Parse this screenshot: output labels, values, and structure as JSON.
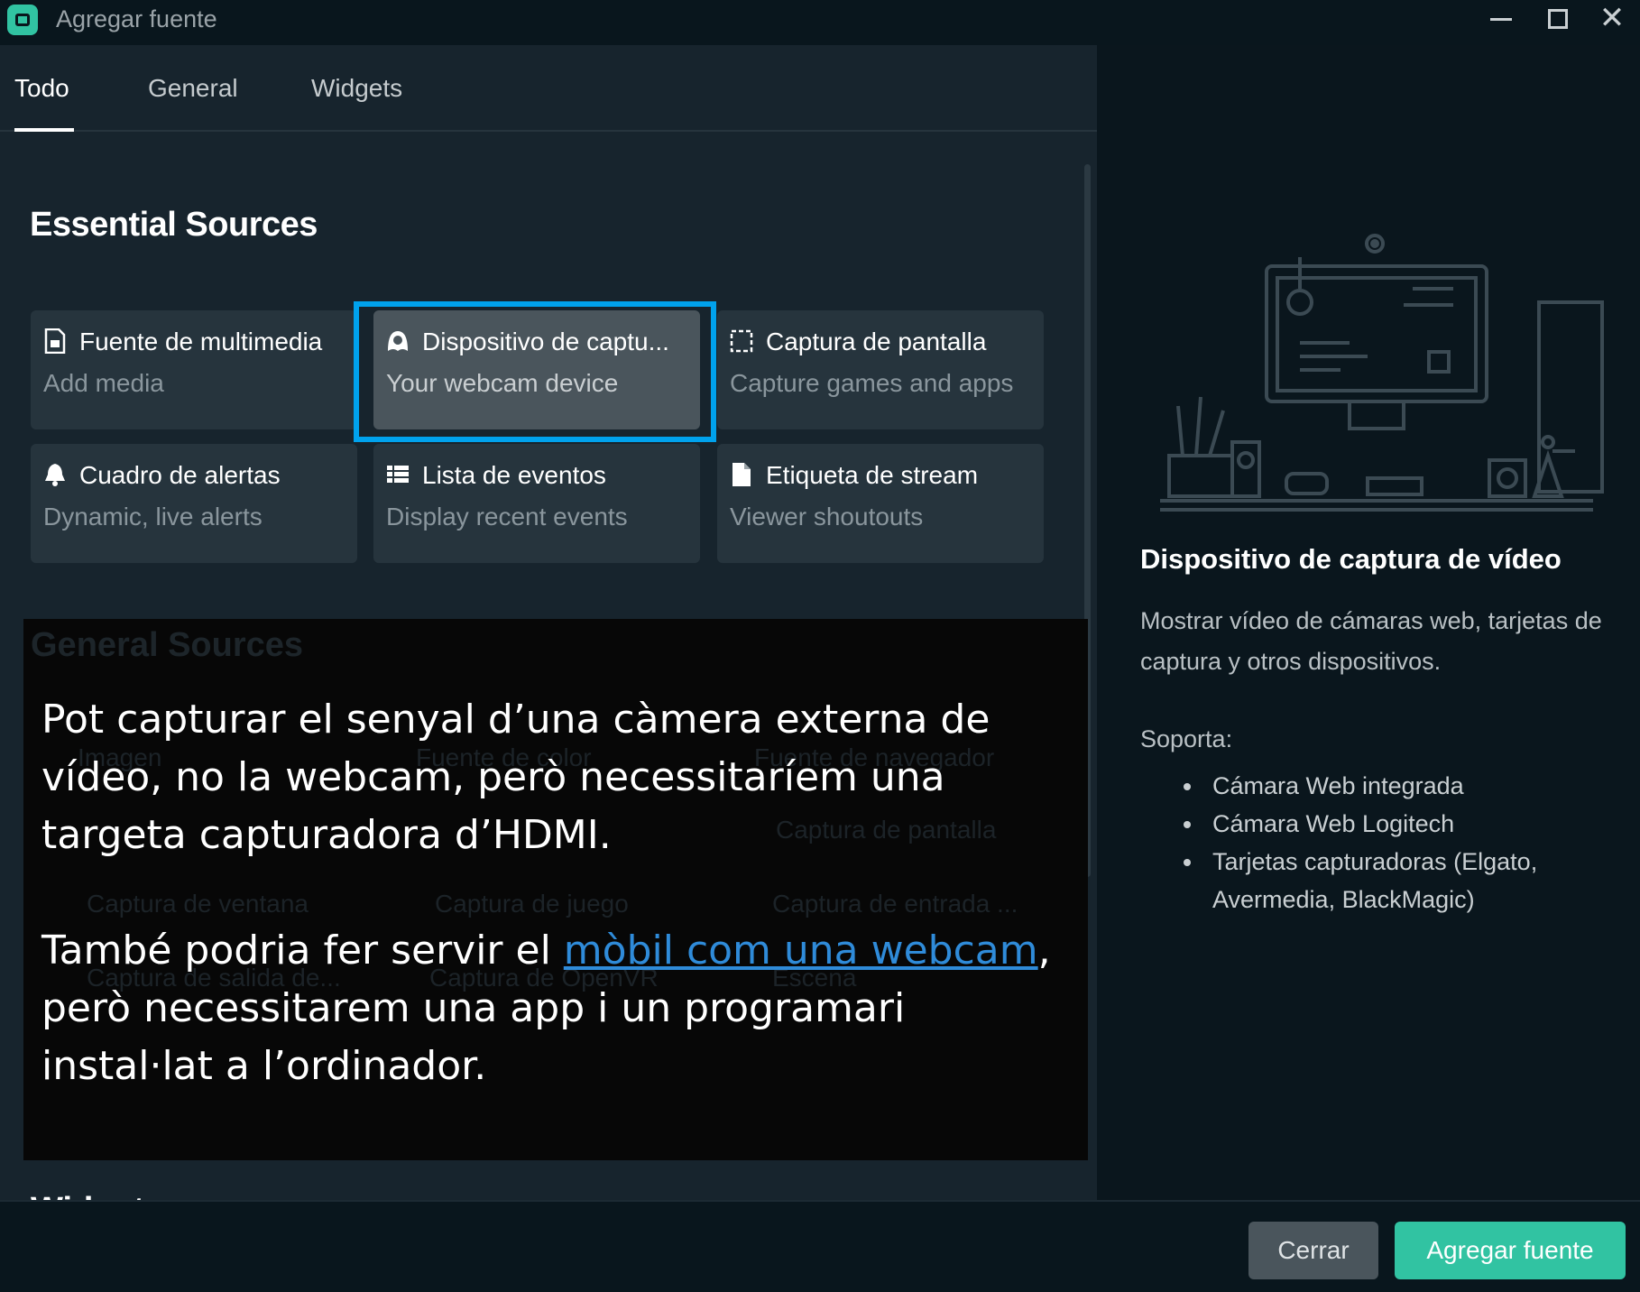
{
  "window": {
    "title": "Agregar fuente",
    "controls": [
      "minimize-icon",
      "maximize-icon",
      "close-icon"
    ]
  },
  "tabs": [
    {
      "label": "Todo",
      "active": true
    },
    {
      "label": "General",
      "active": false
    },
    {
      "label": "Widgets",
      "active": false
    }
  ],
  "essential": {
    "title": "Essential Sources",
    "cards": [
      {
        "title": "Fuente de multimedia",
        "subtitle": "Add media",
        "icon": "media-file-icon",
        "selected": false
      },
      {
        "title": "Dispositivo de captu...",
        "subtitle": "Your webcam device",
        "icon": "webcam-icon",
        "selected": true
      },
      {
        "title": "Captura de pantalla",
        "subtitle": "Capture games and apps",
        "icon": "screen-capture-icon",
        "selected": false
      },
      {
        "title": "Cuadro de alertas",
        "subtitle": "Dynamic, live alerts",
        "icon": "bell-icon",
        "selected": false
      },
      {
        "title": "Lista de eventos",
        "subtitle": "Display recent events",
        "icon": "list-icon",
        "selected": false
      },
      {
        "title": "Etiqueta de stream",
        "subtitle": "Viewer shoutouts",
        "icon": "document-icon",
        "selected": false
      }
    ]
  },
  "general": {
    "title": "General Sources",
    "items": [
      "Imagen",
      "Fuente de color",
      "Fuente de navegador",
      "Captura de pantalla",
      "Captura de ventana",
      "Captura de juego",
      "Captura de entrada ...",
      "Captura de salida de...",
      "Captura de OpenVR",
      "Escena"
    ]
  },
  "widgets_title": "Widgets",
  "annotation": {
    "para1": "Pot capturar el senyal d’una càmera externa de vídeo, no la webcam, però necessitaríem una targeta capturadora d’HDMI.",
    "para2_before": "També podria fer servir el ",
    "para2_link": "mòbil com una webcam",
    "para2_after": ", però necessitarem una app i un programari instal·lat a l’ordinador."
  },
  "details": {
    "title": "Dispositivo de captura de vídeo",
    "description": "Mostrar vídeo de cámaras web, tarjetas de captura y otros dispositivos.",
    "supports_label": "Soporta:",
    "supports": [
      "Cámara Web integrada",
      "Cámara Web Logitech",
      "Tarjetas capturadoras (Elgato, Avermedia, BlackMagic)"
    ]
  },
  "footer": {
    "close_label": "Cerrar",
    "add_label": "Agregar fuente"
  },
  "colors": {
    "accent": "#31c3a2",
    "highlight": "#00a2ed",
    "link": "#2f8bd9",
    "background": "#17242d"
  }
}
